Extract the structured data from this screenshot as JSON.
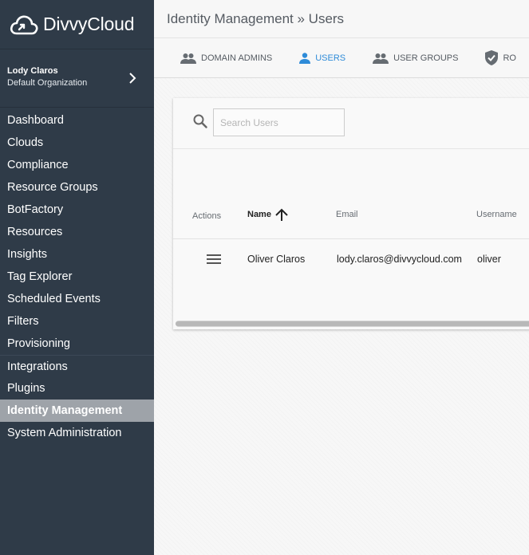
{
  "sidebar": {
    "logo_text": "DivvyCloud",
    "user": {
      "name": "Lody Claros",
      "org": "Default Organization"
    },
    "nav": [
      "Dashboard",
      "Clouds",
      "Compliance",
      "Resource Groups",
      "BotFactory",
      "Resources",
      "Insights",
      "Tag Explorer",
      "Scheduled Events",
      "Filters",
      "Provisioning",
      "Integrations",
      "Plugins",
      "Identity Management",
      "System Administration"
    ],
    "active": "Identity Management"
  },
  "header": {
    "breadcrumb": "Identity Management » Users"
  },
  "tabs": [
    {
      "label": "DOMAIN ADMINS",
      "icon": "group-icon",
      "active": false
    },
    {
      "label": "USERS",
      "icon": "person-icon",
      "active": true
    },
    {
      "label": "USER GROUPS",
      "icon": "group-icon",
      "active": false
    },
    {
      "label": "RO",
      "icon": "shield-check-icon",
      "active": false
    }
  ],
  "search": {
    "placeholder": "Search Users",
    "value": ""
  },
  "table": {
    "columns": {
      "actions": "Actions",
      "name": "Name",
      "email": "Email",
      "username": "Username"
    },
    "sorted_by": "name",
    "sort_dir": "ascending",
    "rows": [
      {
        "name": "Oliver Claros",
        "email": "lody.claros@divvycloud.com",
        "username": "oliver"
      }
    ]
  },
  "colors": {
    "sidebar_bg": "#2f3b48",
    "active_nav_bg": "#9ea3a9",
    "accent": "#2e8bd8"
  }
}
